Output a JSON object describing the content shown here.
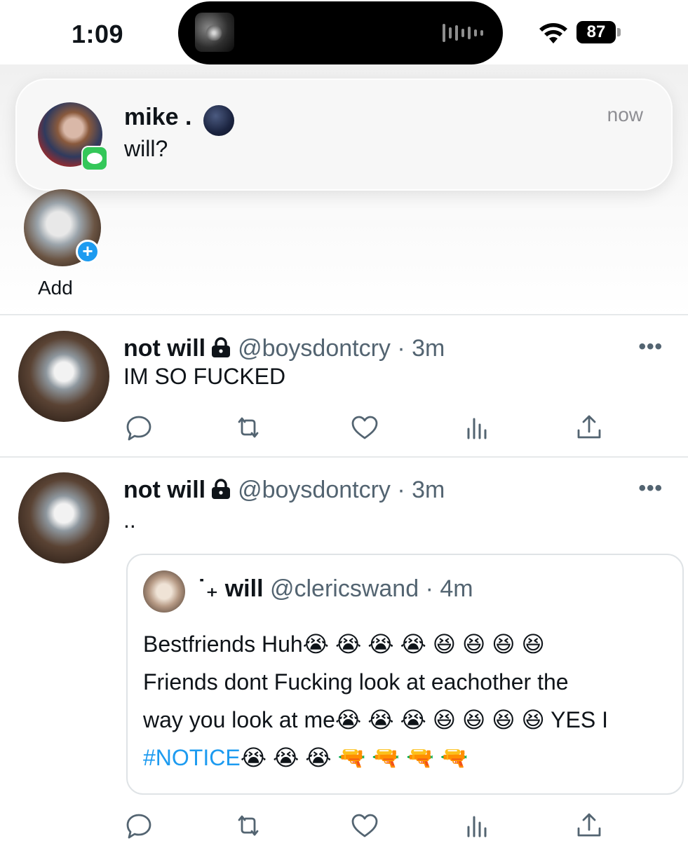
{
  "status_bar": {
    "time": "1:09",
    "battery": "87"
  },
  "notification": {
    "sender": "mike .",
    "message": "will?",
    "time": "now"
  },
  "fleets": {
    "add_label": "Add"
  },
  "tweets": [
    {
      "name": "not will",
      "handle": "@boysdontcry · 3m",
      "text": "IM SO FUCKED"
    },
    {
      "name": "not will",
      "handle": "@boysdontcry · 3m",
      "text": "..",
      "quote": {
        "name_prefix": "˙₊",
        "name": "will",
        "handle": "@clericswand · 4m",
        "line1": "Bestfriends Huh😭 😭 😭 😭 😆 😆 😆 😆",
        "line2": "Friends dont Fucking look at eachother the",
        "line3": "way you look at me😭 😭 😭 😆 😆 😆 😆 YES I",
        "hashtag": "#NOTICE",
        "line4_rest": "😭 😭 😭 🔫 🔫 🔫 🔫"
      }
    }
  ],
  "colors": {
    "accent": "#1d9bf0",
    "messages_green": "#34c759",
    "secondary_text": "#536471"
  },
  "icons": {
    "reply": "reply-icon",
    "retweet": "retweet-icon",
    "like": "like-icon",
    "views": "views-icon",
    "share": "share-icon"
  }
}
